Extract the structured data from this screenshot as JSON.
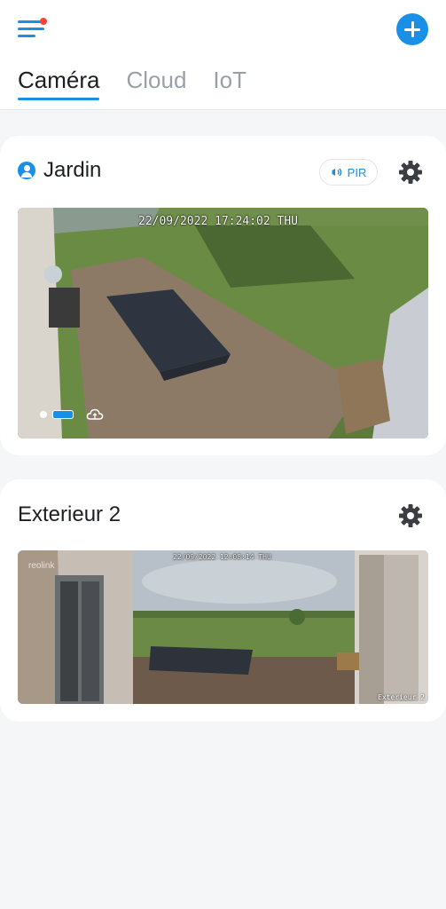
{
  "header": {
    "tabs": [
      {
        "label": "Caméra",
        "active": true
      },
      {
        "label": "Cloud",
        "active": false
      },
      {
        "label": "IoT",
        "active": false
      }
    ],
    "menu_icon": "hamburger-menu-icon",
    "add_icon": "plus-circle-icon",
    "accent_color": "#1a8fe6",
    "notification_color": "#f0463c"
  },
  "cameras": [
    {
      "name": "Jardin",
      "badge": "PIR",
      "osd_timestamp": "22/09/2022 17:24:02 THU",
      "icons": [
        "user-icon",
        "pir-icon",
        "gear-icon",
        "cloud-icon"
      ]
    },
    {
      "name": "Exterieur 2",
      "osd_timestamp": "22/09/2022 12:08:14 THU",
      "watermark": "reolink",
      "osd_label": "Exterieur 2",
      "icons": [
        "gear-icon"
      ]
    }
  ]
}
